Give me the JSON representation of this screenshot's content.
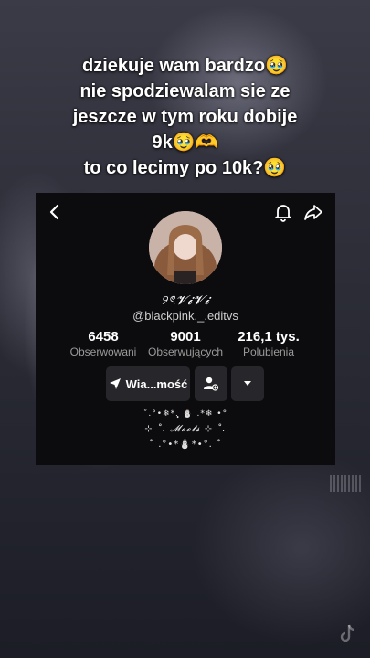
{
  "caption": {
    "line1": "dziekuje wam bardzo🥹",
    "line2": "nie spodziewalam sie ze",
    "line3": "jeszcze w tym roku dobije",
    "line4": "9k🥹🫶",
    "line5": "to co lecimy po 10k?🥹"
  },
  "profile": {
    "display_name": "୨ৎ𝓥𝓲𝓥𝓲",
    "handle": "@blackpink._.editvs",
    "stats": [
      {
        "value": "6458",
        "label": "Obserwowani"
      },
      {
        "value": "9001",
        "label": "Obserwujących"
      },
      {
        "value": "216,1 tys.",
        "label": "Polubienia"
      }
    ],
    "buttons": {
      "message_label": "Wia...mość"
    },
    "bio": {
      "line1": "˚.°•❄︎*.̩̩̥͙ ⛄ .*❄︎ •°",
      "line2": "⊹ ˚. 𝓜𝓸𝓸𝓽𝓼 ⊹ ˚.",
      "line3": "˚ .°•*⛄*•°. ˚"
    }
  },
  "icons": {
    "back": "chevron-left-icon",
    "bell": "bell-icon",
    "share": "share-arrow-icon",
    "send": "paper-plane-icon",
    "add_user": "add-user-icon",
    "dropdown": "caret-down-icon"
  },
  "colors": {
    "card_bg": "#0c0c0e",
    "button_bg": "#27272b",
    "label_gray": "#9a9a9a"
  }
}
